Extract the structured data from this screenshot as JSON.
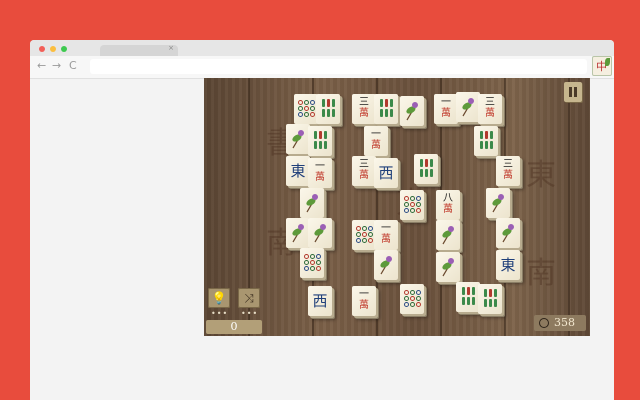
{
  "browser": {
    "tab_close": "×",
    "nav": {
      "back": "←",
      "forward": "→",
      "reload": "C"
    },
    "traffic_colors": [
      "#f25f58",
      "#fbbe3f",
      "#3dc94f"
    ],
    "extension_glyph": "中"
  },
  "game": {
    "score": "0",
    "timer": "358",
    "background_glyphs": [
      "書",
      "東",
      "南",
      "東",
      "南"
    ],
    "controls": {
      "hint_icon": "lightbulb-icon",
      "shuffle_icon": "shuffle-icon",
      "pause_icon": "pause-icon",
      "hint_dots": "•••",
      "shuffle_dots": "•••"
    },
    "tiles": [
      {
        "kind": "dots"
      },
      {
        "kind": "bamboo"
      },
      {
        "kind": "char",
        "label": "三",
        "sub": "萬"
      },
      {
        "kind": "bamboo"
      },
      {
        "kind": "flower"
      },
      {
        "kind": "char",
        "label": "一",
        "sub": "萬"
      },
      {
        "kind": "flower"
      },
      {
        "kind": "char",
        "label": "三",
        "sub": "萬"
      },
      {
        "kind": "flower"
      },
      {
        "kind": "bamboo"
      },
      {
        "kind": "char",
        "label": "一",
        "sub": "萬"
      },
      {
        "kind": "bamboo"
      },
      {
        "kind": "wind",
        "label": "東"
      },
      {
        "kind": "char",
        "label": "一",
        "sub": "萬"
      },
      {
        "kind": "char",
        "label": "三",
        "sub": "萬"
      },
      {
        "kind": "wind",
        "label": "西"
      },
      {
        "kind": "bamboo"
      },
      {
        "kind": "char",
        "label": "三",
        "sub": "萬"
      },
      {
        "kind": "flower"
      },
      {
        "kind": "dots"
      },
      {
        "kind": "char",
        "label": "八",
        "sub": "萬"
      },
      {
        "kind": "flower"
      },
      {
        "kind": "flower"
      },
      {
        "kind": "flower"
      },
      {
        "kind": "dots"
      },
      {
        "kind": "char",
        "label": "一",
        "sub": "萬"
      },
      {
        "kind": "flower"
      },
      {
        "kind": "flower"
      },
      {
        "kind": "dots"
      },
      {
        "kind": "flower"
      },
      {
        "kind": "flower"
      },
      {
        "kind": "wind",
        "label": "東"
      },
      {
        "kind": "wind",
        "label": "西"
      },
      {
        "kind": "char",
        "label": "一",
        "sub": "萬"
      },
      {
        "kind": "bamboo"
      },
      {
        "kind": "bamboo"
      },
      {
        "kind": "dots"
      }
    ]
  }
}
